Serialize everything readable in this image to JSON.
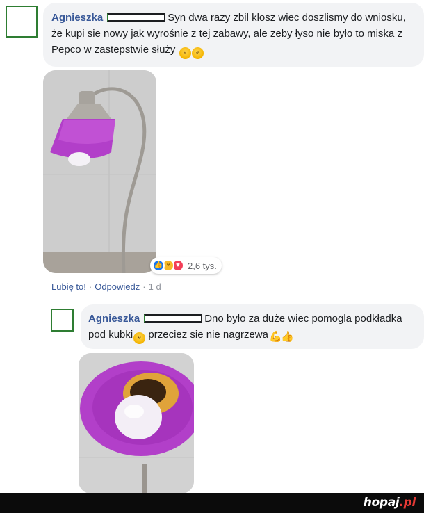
{
  "comment": {
    "author": "Agnieszka",
    "text": "Syn dwa razy zbil klosz wiec doszlismy do wniosku, że kupi sie nowy jak wyrośnie z tej zabawy, ale zeby łyso nie było to miska z Pepco w zastepstwie służy",
    "emojis": [
      "laughing-emoji",
      "rofl-emoji"
    ],
    "photo_alt": "lamp with purple bowl shade",
    "reactions": {
      "icons": [
        "like-icon",
        "haha-icon",
        "love-icon"
      ],
      "count": "2,6 tys."
    },
    "actions": {
      "like": "Lubię to!",
      "reply": "Odpowiedz",
      "separator": "·",
      "time": "1 d"
    }
  },
  "reply": {
    "author": "Agnieszka",
    "text_before_emoji": "Dno było za duże wiec pomogla podkładka pod kubki",
    "text_after_emoji": " przeciez sie nie nagrzewa",
    "emojis": [
      "laughing-emoji",
      "flexed-biceps-emoji",
      "thumbs-up-emoji"
    ],
    "photo_alt": "purple bowl shade with bulb and coaster"
  },
  "footer": {
    "logo_main": "hopaj",
    "logo_tld": ".pl"
  },
  "colors": {
    "author": "#385898",
    "bubble": "#f2f3f5",
    "censor_green": "#2e7d32",
    "shade_purple": "#b23fc9",
    "footer_bg": "#0b0b0b",
    "logo_accent": "#e53935"
  }
}
